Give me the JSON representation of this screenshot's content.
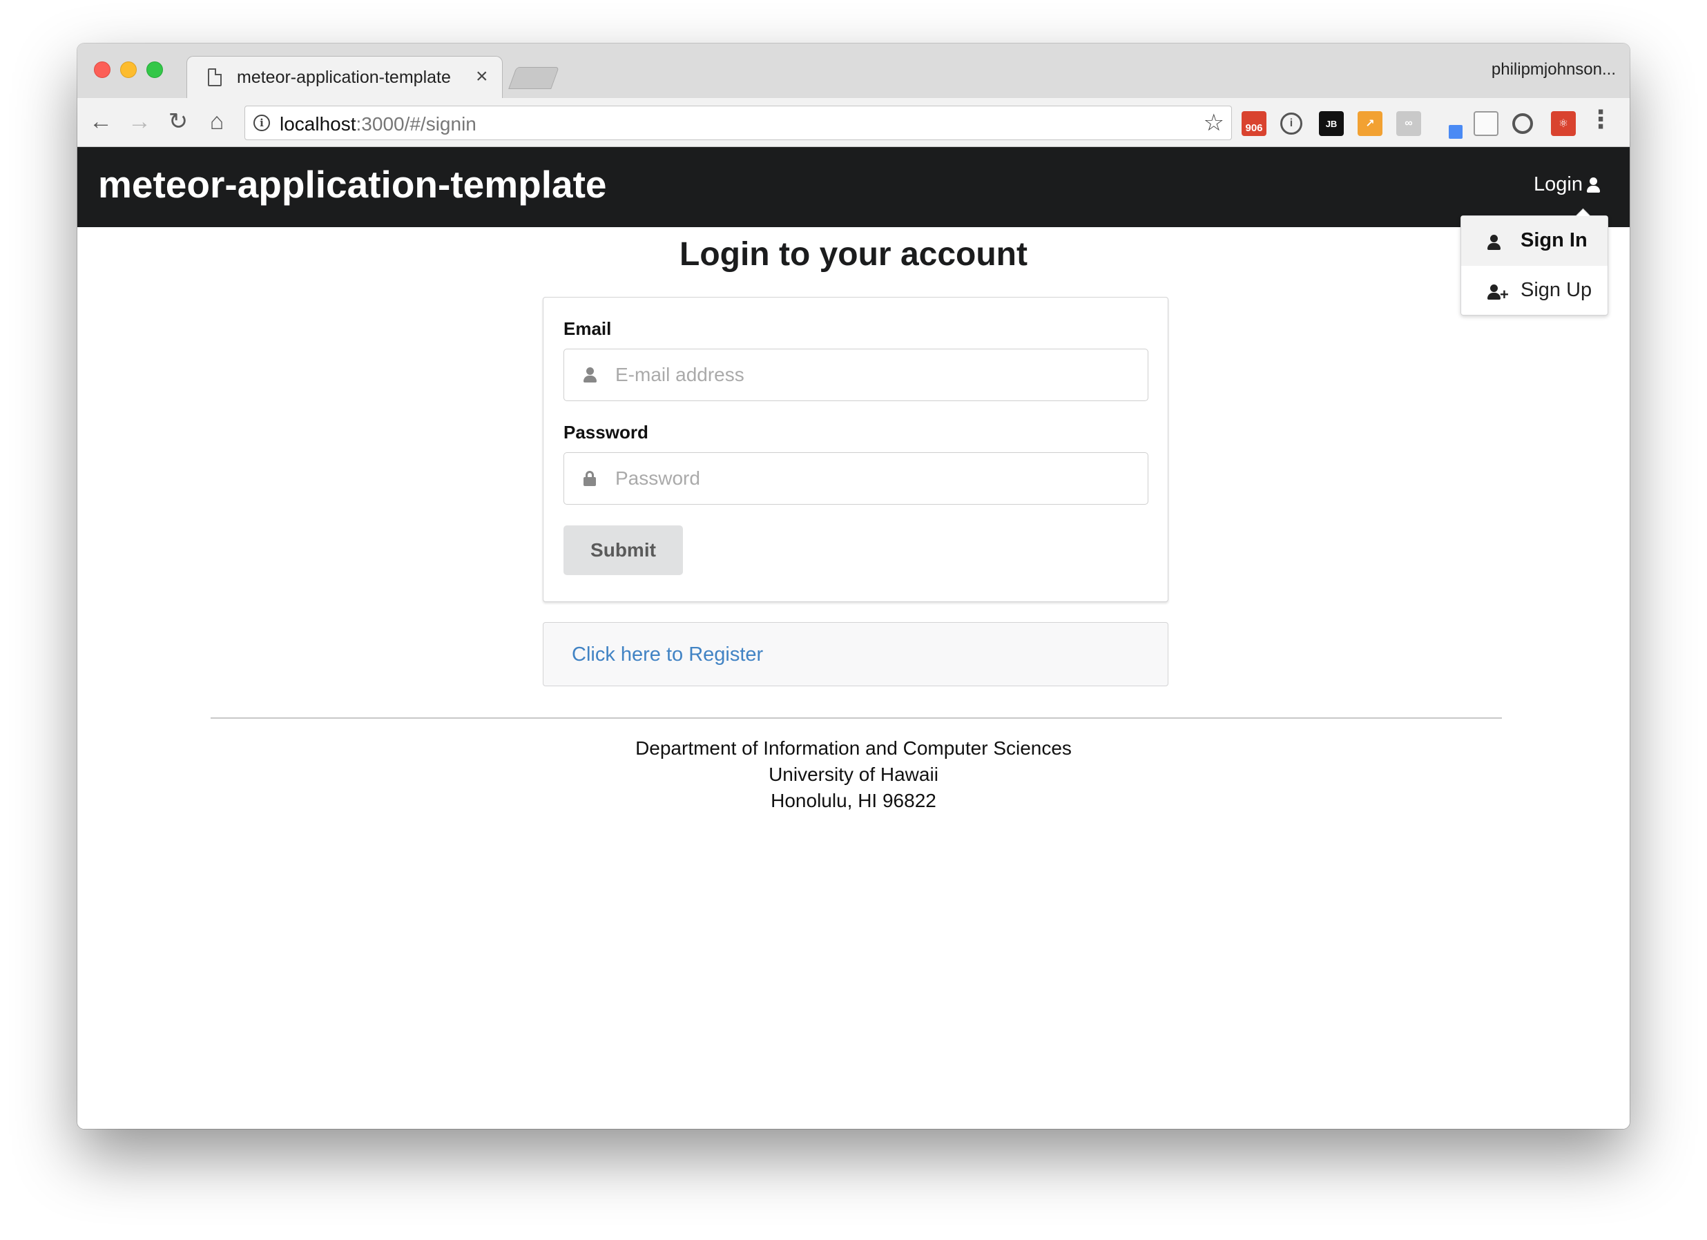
{
  "browser": {
    "tab_title": "meteor-application-template",
    "tab_close": "×",
    "profile_name": "philipmjohnson...",
    "url_host": "localhost",
    "url_path": ":3000/#/signin",
    "extensions": [
      {
        "name": "906-badge-extension",
        "label": "906"
      },
      {
        "name": "1password-extension",
        "label": "i"
      },
      {
        "name": "jetbrains-extension",
        "label": "JB"
      },
      {
        "name": "analytics-extension",
        "label": ""
      },
      {
        "name": "link-extension",
        "label": ""
      },
      {
        "name": "color-dropper-extension",
        "label": ""
      },
      {
        "name": "page-extension",
        "label": ""
      },
      {
        "name": "sync-extension",
        "label": ""
      },
      {
        "name": "react-devtools-extension",
        "label": ""
      }
    ]
  },
  "app": {
    "brand": "meteor-application-template",
    "login_label": "Login",
    "dropdown": {
      "sign_in": "Sign In",
      "sign_up": "Sign Up"
    }
  },
  "signin": {
    "heading": "Login to your account",
    "email_label": "Email",
    "email_placeholder": "E-mail address",
    "email_value": "",
    "password_label": "Password",
    "password_placeholder": "Password",
    "password_value": "",
    "submit_label": "Submit",
    "register_link": "Click here to Register"
  },
  "footer": {
    "line1": "Department of Information and Computer Sciences",
    "line2": "University of Hawaii",
    "line3": "Honolulu, HI 96822"
  },
  "colors": {
    "navbar_bg": "#1b1c1d",
    "link": "#4183c4",
    "button_bg": "#e0e1e2"
  }
}
